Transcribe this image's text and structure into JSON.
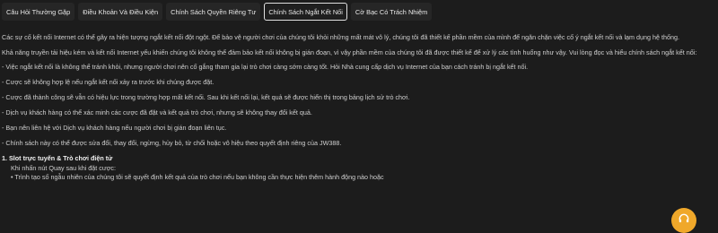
{
  "tabs": [
    {
      "label": "Câu Hỏi Thường Gặp"
    },
    {
      "label": "Điều Khoản Và Điều Kiện"
    },
    {
      "label": "Chính Sách Quyền Riêng Tư"
    },
    {
      "label": "Chính Sách Ngắt Kết Nối"
    },
    {
      "label": "Cờ Bạc Có Trách Nhiệm"
    }
  ],
  "active_tab": "Chính Sách Ngắt Kết Nối",
  "content": {
    "para1": "Các sự cố kết nối Internet có thể gây ra hiện tượng ngắt kết nối đột ngột. Để bảo vệ người chơi của chúng tôi khỏi những mất mát vô lý, chúng tôi đã thiết kế phần mềm của mình để ngăn chặn việc cố ý ngắt kết nối và lạm dụng hệ thống.",
    "para2": "Khả năng truyền tải hiệu kém và kết nối Internet yếu khiến chúng tôi không thể đảm bảo kết nối không bị gián đoạn, vì vậy phần mềm của chúng tôi đã được thiết kế để xử lý các tình huống như vậy. Vui lòng đọc và hiểu chính sách ngắt kết nối:",
    "bullets": [
      "- Việc ngắt kết nối là không thể tránh khỏi, nhưng người chơi nên cố gắng tham gia lại trò chơi càng sớm càng tốt. Hỏi Nhà cung cấp dịch vụ Internet của bạn cách tránh bị ngắt kết nối.",
      "- Cược sẽ không hợp lệ nếu ngắt kết nối xảy ra trước khi chúng được đặt.",
      "- Cược đã thành công sẽ vẫn có hiệu lực trong trường hợp mất kết nối. Sau khi kết nối lại, kết quả sẽ được hiển thị trong bảng lịch sử trò chơi.",
      "- Dịch vụ khách hàng có thể xác minh các cược đã đặt và kết quả trò chơi, nhưng sẽ không thay đổi kết quả.",
      "- Bạn nên liên hệ với Dịch vụ khách hàng nếu người chơi bị gián đoạn liên tục.",
      "- Chính sách này có thể được sửa đổi, thay đổi, ngừng, hủy bỏ, từ chối hoặc vô hiệu theo quyết định riêng của JW388."
    ],
    "heading": "1. Slot trực tuyến & Trò chơi điện tử",
    "subline": "Khi nhấn nút Quay sau khi đặt cược:",
    "subbullet": "• Trình tạo số ngẫu nhiên của chúng tôi sẽ quyết định kết quả của trò chơi nếu bạn không cần thực hiện thêm hành động nào hoặc"
  },
  "support_button": {
    "icon": "headset-icon",
    "color": "#f0a82a"
  }
}
